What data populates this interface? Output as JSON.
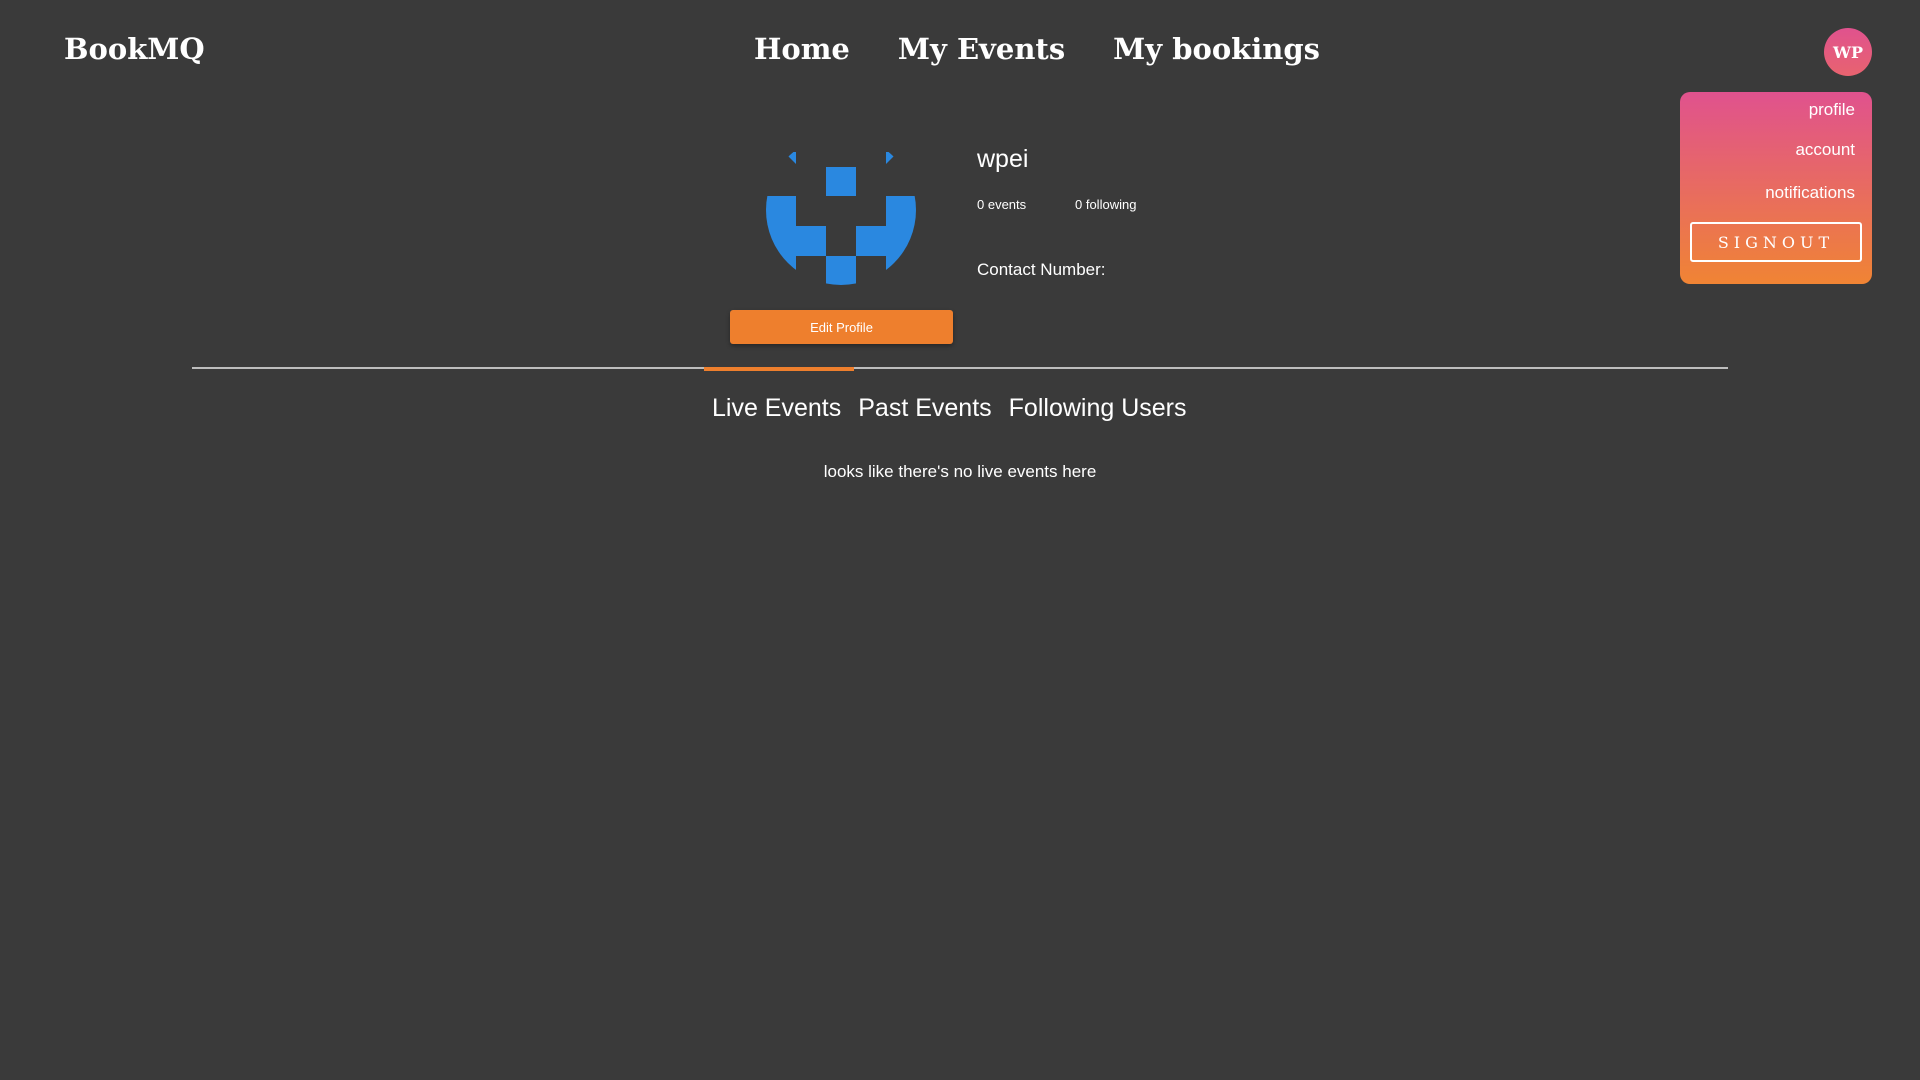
{
  "header": {
    "brand": "BookMQ",
    "nav": [
      "Home",
      "My Events",
      "My bookings"
    ],
    "avatar_initials": "WP"
  },
  "dropdown": {
    "items": [
      "profile",
      "account",
      "notifications"
    ],
    "signout_label": "SIGNOUT"
  },
  "profile": {
    "username": "wpei",
    "events_count": "0 events",
    "following_count": "0 following",
    "contact_label": "Contact Number:",
    "edit_label": "Edit Profile"
  },
  "tabs": {
    "items": [
      "Live Events",
      "Past Events",
      "Following Users"
    ],
    "active": "Live Events",
    "empty_message": "looks like there's no live events here"
  },
  "colors": {
    "background": "#3a3a3a",
    "accent": "#ee7f2d",
    "pink": "#e0528e",
    "identicon": "#2a88e0"
  }
}
